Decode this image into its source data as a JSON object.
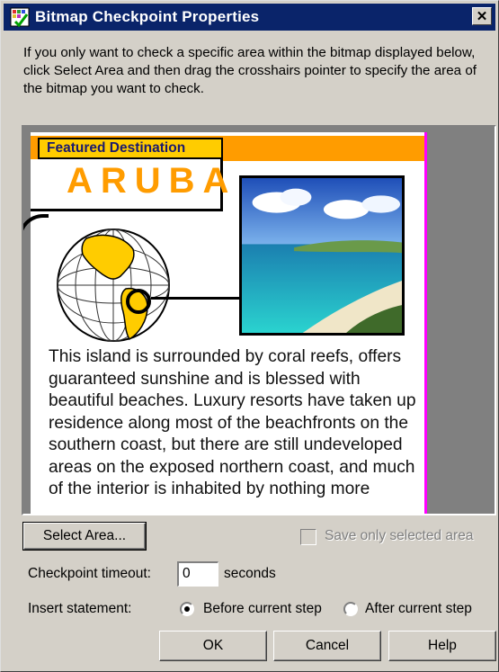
{
  "window": {
    "title": "Bitmap Checkpoint Properties",
    "close_label": "✕"
  },
  "description": "If you only want to check a specific area within the bitmap displayed below, click Select Area and then drag the crosshairs pointer to specify the area of the bitmap you want to check.",
  "bitmap": {
    "featured_label": "Featured Destination",
    "destination_title": "ARUBA",
    "body_text": "This island is surrounded by coral reefs, offers guaranteed sunshine and is blessed with beautiful beaches. Luxury resorts have taken up residence along most of the beachfronts on the southern coast, but there are still undeveloped areas on the exposed northern coast, and much of the interior is inhabited by nothing more"
  },
  "controls": {
    "select_area_label": "Select Area...",
    "save_only_label": "Save only selected area",
    "save_only_checked": false,
    "timeout_label": "Checkpoint timeout:",
    "timeout_value": "0",
    "timeout_units": "seconds",
    "insert_label": "Insert statement:",
    "insert_options": [
      {
        "label": "Before current step",
        "selected": true
      },
      {
        "label": "After current step",
        "selected": false
      }
    ]
  },
  "buttons": {
    "ok": "OK",
    "cancel": "Cancel",
    "help": "Help"
  },
  "colors": {
    "titlebar": "#0a246a",
    "orange_accent": "#ff9c00",
    "featured_bg": "#ffcc00",
    "magenta_line": "#ff00ff"
  }
}
